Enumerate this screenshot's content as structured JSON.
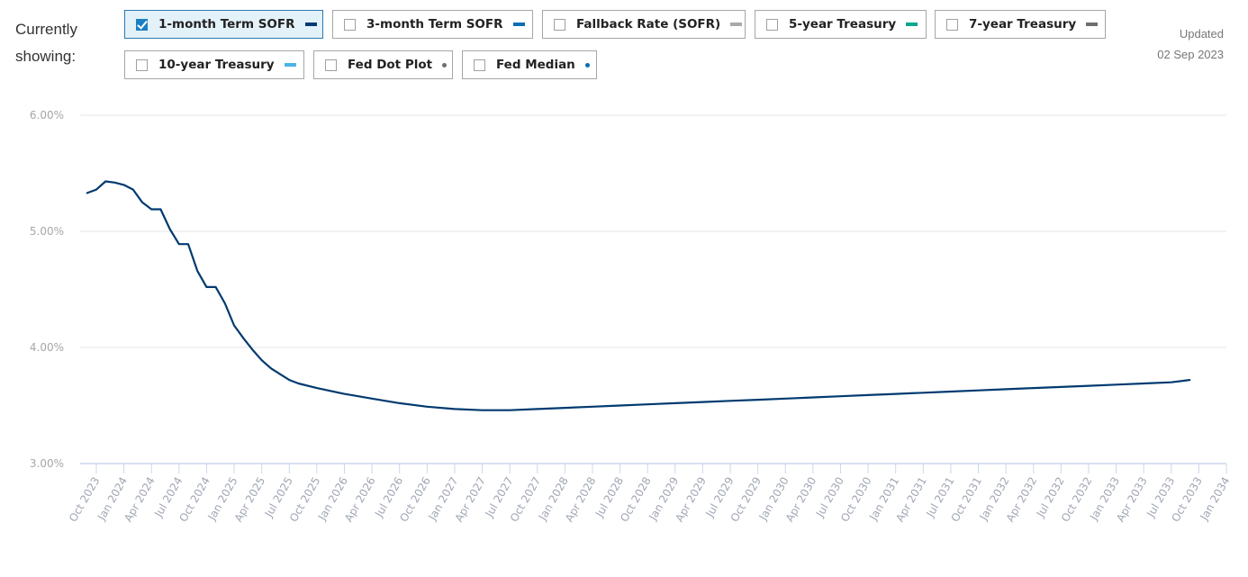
{
  "header": {
    "showing_label_line1": "Currently",
    "showing_label_line2": "showing:",
    "updated_label": "Updated",
    "updated_date": "02 Sep 2023"
  },
  "legend": [
    {
      "label": "1-month Term SOFR",
      "checked": true,
      "color": "#003a70",
      "marker": "line"
    },
    {
      "label": "3-month Term SOFR",
      "checked": false,
      "color": "#0a6fb5",
      "marker": "line"
    },
    {
      "label": "Fallback Rate (SOFR)",
      "checked": false,
      "color": "#a7a9ac",
      "marker": "line"
    },
    {
      "label": "5-year Treasury",
      "checked": false,
      "color": "#00a88e",
      "marker": "line"
    },
    {
      "label": "7-year Treasury",
      "checked": false,
      "color": "#6d6e71",
      "marker": "line"
    },
    {
      "label": "10-year Treasury",
      "checked": false,
      "color": "#4cb3e6",
      "marker": "line"
    },
    {
      "label": "Fed Dot Plot",
      "checked": false,
      "color": "#6d6e71",
      "marker": "dot"
    },
    {
      "label": "Fed Median",
      "checked": false,
      "color": "#0a6fb5",
      "marker": "dot"
    }
  ],
  "chart_data": {
    "type": "line",
    "title": "",
    "xlabel": "",
    "ylabel": "",
    "ylim": [
      3.0,
      6.0
    ],
    "yticks": [
      3.0,
      4.0,
      5.0,
      6.0
    ],
    "ytick_labels": [
      "3.00%",
      "4.00%",
      "5.00%",
      "6.00%"
    ],
    "grid": true,
    "xticks": [
      "Oct 2023",
      "Jan 2024",
      "Apr 2024",
      "Jul 2024",
      "Oct 2024",
      "Jan 2025",
      "Apr 2025",
      "Jul 2025",
      "Oct 2025",
      "Jan 2026",
      "Apr 2026",
      "Jul 2026",
      "Oct 2026",
      "Jan 2027",
      "Apr 2027",
      "Jul 2027",
      "Oct 2027",
      "Jan 2028",
      "Apr 2028",
      "Jul 2028",
      "Oct 2028",
      "Jan 2029",
      "Apr 2029",
      "Jul 2029",
      "Oct 2029",
      "Jan 2030",
      "Apr 2030",
      "Jul 2030",
      "Oct 2030",
      "Jan 2031",
      "Apr 2031",
      "Jul 2031",
      "Oct 2031",
      "Jan 2032",
      "Apr 2032",
      "Jul 2032",
      "Oct 2032",
      "Jan 2033",
      "Apr 2033",
      "Jul 2033",
      "Oct 2033",
      "Jan 2034"
    ],
    "xrange_months_from_oct2023": [
      0,
      123
    ],
    "series": [
      {
        "name": "1-month Term SOFR",
        "color": "#003a70",
        "points": [
          {
            "date": "Sep 2023",
            "m": -1,
            "value": 5.33
          },
          {
            "date": "Oct 2023",
            "m": 0,
            "value": 5.36
          },
          {
            "date": "Nov 2023",
            "m": 1,
            "value": 5.43
          },
          {
            "date": "Dec 2023",
            "m": 2,
            "value": 5.42
          },
          {
            "date": "Jan 2024",
            "m": 3,
            "value": 5.4
          },
          {
            "date": "Feb 2024",
            "m": 4,
            "value": 5.36
          },
          {
            "date": "Mar 2024",
            "m": 5,
            "value": 5.25
          },
          {
            "date": "Apr 2024",
            "m": 6,
            "value": 5.19
          },
          {
            "date": "May 2024",
            "m": 7,
            "value": 5.19
          },
          {
            "date": "Jun 2024",
            "m": 8,
            "value": 5.02
          },
          {
            "date": "Jul 2024",
            "m": 9,
            "value": 4.89
          },
          {
            "date": "Aug 2024",
            "m": 10,
            "value": 4.89
          },
          {
            "date": "Sep 2024",
            "m": 11,
            "value": 4.66
          },
          {
            "date": "Oct 2024",
            "m": 12,
            "value": 4.52
          },
          {
            "date": "Nov 2024",
            "m": 13,
            "value": 4.52
          },
          {
            "date": "Dec 2024",
            "m": 14,
            "value": 4.38
          },
          {
            "date": "Jan 2025",
            "m": 15,
            "value": 4.19
          },
          {
            "date": "Feb 2025",
            "m": 16,
            "value": 4.08
          },
          {
            "date": "Mar 2025",
            "m": 17,
            "value": 3.98
          },
          {
            "date": "Apr 2025",
            "m": 18,
            "value": 3.89
          },
          {
            "date": "May 2025",
            "m": 19,
            "value": 3.82
          },
          {
            "date": "Jun 2025",
            "m": 20,
            "value": 3.77
          },
          {
            "date": "Jul 2025",
            "m": 21,
            "value": 3.72
          },
          {
            "date": "Aug 2025",
            "m": 22,
            "value": 3.69
          },
          {
            "date": "Oct 2025",
            "m": 24,
            "value": 3.65
          },
          {
            "date": "Jan 2026",
            "m": 27,
            "value": 3.6
          },
          {
            "date": "Apr 2026",
            "m": 30,
            "value": 3.56
          },
          {
            "date": "Jul 2026",
            "m": 33,
            "value": 3.52
          },
          {
            "date": "Oct 2026",
            "m": 36,
            "value": 3.49
          },
          {
            "date": "Jan 2027",
            "m": 39,
            "value": 3.47
          },
          {
            "date": "Apr 2027",
            "m": 42,
            "value": 3.46
          },
          {
            "date": "Jul 2027",
            "m": 45,
            "value": 3.46
          },
          {
            "date": "Oct 2027",
            "m": 48,
            "value": 3.47
          },
          {
            "date": "Jan 2028",
            "m": 51,
            "value": 3.48
          },
          {
            "date": "Apr 2028",
            "m": 54,
            "value": 3.49
          },
          {
            "date": "Jul 2028",
            "m": 57,
            "value": 3.5
          },
          {
            "date": "Oct 2028",
            "m": 60,
            "value": 3.51
          },
          {
            "date": "Jan 2029",
            "m": 63,
            "value": 3.52
          },
          {
            "date": "Apr 2029",
            "m": 66,
            "value": 3.53
          },
          {
            "date": "Jul 2029",
            "m": 69,
            "value": 3.54
          },
          {
            "date": "Oct 2029",
            "m": 72,
            "value": 3.55
          },
          {
            "date": "Jan 2030",
            "m": 75,
            "value": 3.56
          },
          {
            "date": "Apr 2030",
            "m": 78,
            "value": 3.57
          },
          {
            "date": "Jul 2030",
            "m": 81,
            "value": 3.58
          },
          {
            "date": "Oct 2030",
            "m": 84,
            "value": 3.59
          },
          {
            "date": "Jan 2031",
            "m": 87,
            "value": 3.6
          },
          {
            "date": "Apr 2031",
            "m": 90,
            "value": 3.61
          },
          {
            "date": "Jul 2031",
            "m": 93,
            "value": 3.62
          },
          {
            "date": "Oct 2031",
            "m": 96,
            "value": 3.63
          },
          {
            "date": "Jan 2032",
            "m": 99,
            "value": 3.64
          },
          {
            "date": "Apr 2032",
            "m": 102,
            "value": 3.65
          },
          {
            "date": "Jul 2032",
            "m": 105,
            "value": 3.66
          },
          {
            "date": "Oct 2032",
            "m": 108,
            "value": 3.67
          },
          {
            "date": "Jan 2033",
            "m": 111,
            "value": 3.68
          },
          {
            "date": "Apr 2033",
            "m": 114,
            "value": 3.69
          },
          {
            "date": "Jul 2033",
            "m": 117,
            "value": 3.7
          },
          {
            "date": "Sep 2033",
            "m": 119,
            "value": 3.72
          }
        ]
      }
    ]
  }
}
